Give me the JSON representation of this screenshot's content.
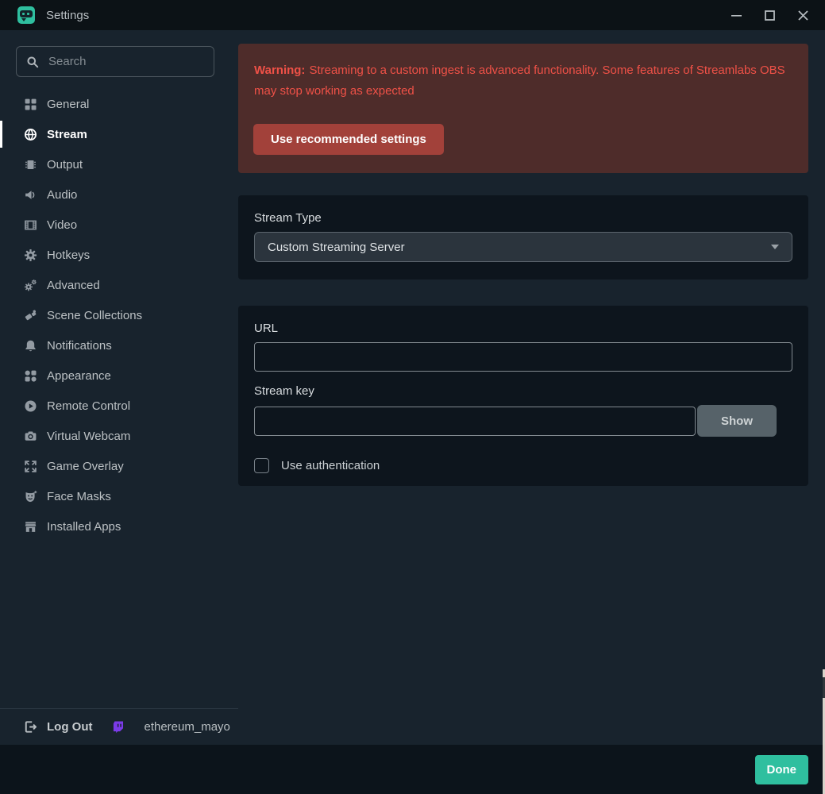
{
  "titlebar": {
    "title": "Settings"
  },
  "sidebar": {
    "search_placeholder": "Search",
    "items": [
      {
        "label": "General",
        "icon": "grid-icon",
        "active": false
      },
      {
        "label": "Stream",
        "icon": "globe-icon",
        "active": true
      },
      {
        "label": "Output",
        "icon": "chip-icon",
        "active": false
      },
      {
        "label": "Audio",
        "icon": "speaker-icon",
        "active": false
      },
      {
        "label": "Video",
        "icon": "film-icon",
        "active": false
      },
      {
        "label": "Hotkeys",
        "icon": "gear-icon",
        "active": false
      },
      {
        "label": "Advanced",
        "icon": "gears-icon",
        "active": false
      },
      {
        "label": "Scene Collections",
        "icon": "collage-icon",
        "active": false
      },
      {
        "label": "Notifications",
        "icon": "bell-icon",
        "active": false
      },
      {
        "label": "Appearance",
        "icon": "shapes-icon",
        "active": false
      },
      {
        "label": "Remote Control",
        "icon": "play-circle-icon",
        "active": false
      },
      {
        "label": "Virtual Webcam",
        "icon": "camera-icon",
        "active": false
      },
      {
        "label": "Game Overlay",
        "icon": "expand-arrows-icon",
        "active": false
      },
      {
        "label": "Face Masks",
        "icon": "mask-icon",
        "active": false
      },
      {
        "label": "Installed Apps",
        "icon": "storefront-icon",
        "active": false
      }
    ],
    "logout_label": "Log Out",
    "account_name": "ethereum_mayo"
  },
  "warning": {
    "prefix": "Warning:",
    "message": "Streaming to a custom ingest is advanced functionality. Some features of Streamlabs OBS may stop working as expected",
    "button_label": "Use recommended settings"
  },
  "stream": {
    "type_label": "Stream Type",
    "type_value": "Custom Streaming Server",
    "url_label": "URL",
    "url_value": "",
    "key_label": "Stream key",
    "key_value": "",
    "show_label": "Show",
    "auth_label": "Use authentication",
    "auth_checked": false
  },
  "footer": {
    "done_label": "Done"
  },
  "colors": {
    "accent_green": "#2fbf9f",
    "warning_bg": "#4e2c2a",
    "warning_text": "#ef5147",
    "warning_button": "#a2413a",
    "twitch_purple": "#7b3be8"
  }
}
